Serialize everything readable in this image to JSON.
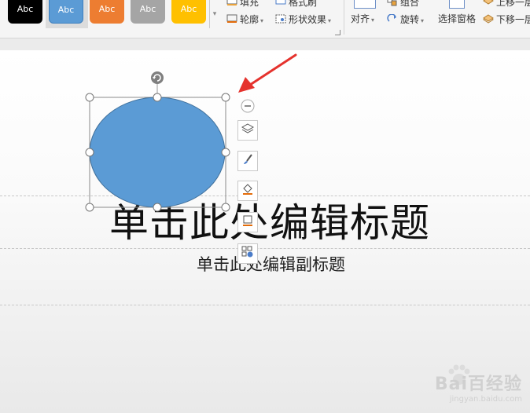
{
  "ribbon": {
    "shape_styles": [
      {
        "label": "Abc",
        "color": "#000000",
        "text_color": "#ffffff"
      },
      {
        "label": "Abc",
        "color": "#5b9bd5",
        "text_color": "#ffffff"
      },
      {
        "label": "Abc",
        "color": "#ed7d31",
        "text_color": "#ffffff"
      },
      {
        "label": "Abc",
        "color": "#a5a5a5",
        "text_color": "#ffffff"
      },
      {
        "label": "Abc",
        "color": "#ffc000",
        "text_color": "#ffffff"
      }
    ],
    "fill_label": "填充",
    "outline_label": "轮廓",
    "format_painter_label": "格式刷",
    "shape_effects_label": "形状效果",
    "align_label": "对齐",
    "group_label": "组合",
    "rotate_label": "旋转",
    "selection_pane_label": "选择窗格",
    "bring_forward_label": "上移一层",
    "send_backward_label": "下移一层"
  },
  "slide": {
    "title_placeholder": "单击此处编辑标题",
    "subtitle_placeholder": "单击此处编辑副标题",
    "shape_fill": "#5b9bd5"
  },
  "watermark": {
    "brand": "Bai百经验",
    "url": "jingyan.baidu.com"
  }
}
